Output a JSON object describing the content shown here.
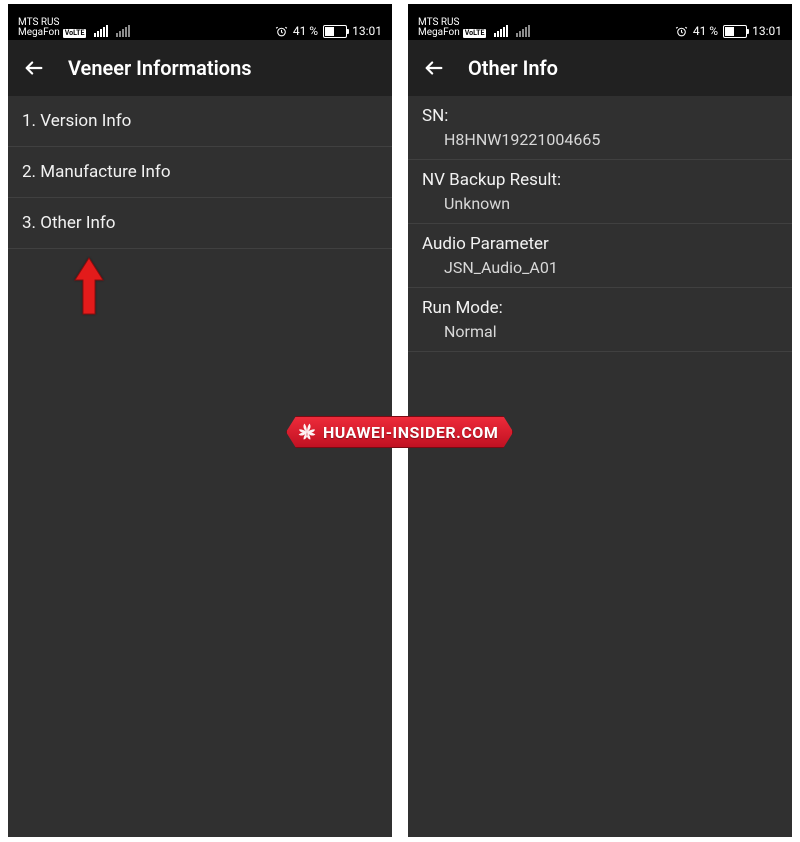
{
  "statusbar": {
    "carrier1": "MTS RUS",
    "carrier2": "MegaFon",
    "volte_label": "VoLTE",
    "battery_text": "41 %",
    "time": "13:01"
  },
  "left_screen": {
    "title": "Veneer Informations",
    "items": [
      {
        "label": "1. Version Info"
      },
      {
        "label": "2. Manufacture Info"
      },
      {
        "label": "3. Other Info"
      }
    ]
  },
  "right_screen": {
    "title": "Other Info",
    "items": [
      {
        "label": "SN:",
        "value": "H8HNW19221004665"
      },
      {
        "label": "NV Backup Result:",
        "value": "Unknown"
      },
      {
        "label": "Audio Parameter",
        "value": "JSN_Audio_A01"
      },
      {
        "label": "Run Mode:",
        "value": "Normal"
      }
    ]
  },
  "watermark": {
    "text": "HUAWEI-INSIDER.COM"
  }
}
